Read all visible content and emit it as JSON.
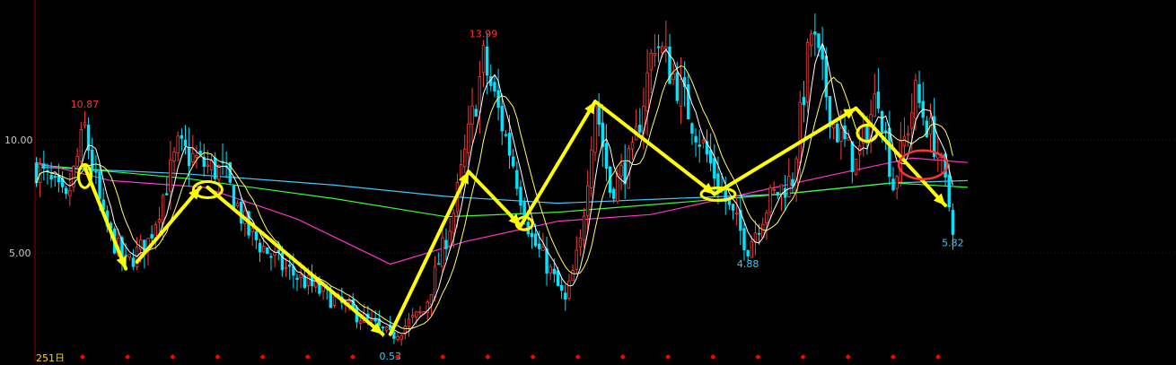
{
  "colors": {
    "background": "#000000",
    "axis": "#8b0000",
    "grid": "#7a0000",
    "axis_label": "#c8c8c8",
    "up_candle": "#ff3c3c",
    "down_candle": "#00e5ff",
    "ma_short": "#ffffff",
    "ma_mid": "#ffff66",
    "ma_long_magenta": "#ff33cc",
    "ma_long_green": "#33ff33",
    "ma_long_cyan": "#3cc8ff",
    "annotation": "#ffff00",
    "annotation_circle_red": "#ff3333",
    "high_label": "#ff3333",
    "low_label": "#33ccff",
    "date_label": "#ffd700",
    "event_marker": "#ff0000"
  },
  "chart_data": {
    "type": "candlestick",
    "y_axis": {
      "ticks": [
        "10.00",
        "5.00"
      ],
      "tick_values": [
        10,
        5
      ],
      "range": [
        0.3,
        15.9
      ]
    },
    "x_axis": {
      "label": "251日",
      "event_markers": 20
    },
    "price_labels": [
      {
        "text": "10.87",
        "value": 10.87,
        "kind": "high",
        "bar": 13
      },
      {
        "text": "13.99",
        "value": 13.99,
        "kind": "high",
        "bar": 120
      },
      {
        "text": "4.88",
        "value": 4.88,
        "kind": "low",
        "bar": 191
      },
      {
        "text": "5.82",
        "value": 5.82,
        "kind": "low",
        "bar": 246
      },
      {
        "text": "0.53",
        "value": 0.53,
        "kind": "low",
        "bar": 95
      }
    ],
    "price_path": [
      [
        0,
        8.8
      ],
      [
        8,
        7.2
      ],
      [
        13,
        10.5
      ],
      [
        18,
        6.4
      ],
      [
        24,
        4.5
      ],
      [
        30,
        5.5
      ],
      [
        38,
        9.6
      ],
      [
        46,
        8.8
      ],
      [
        50,
        8.6
      ],
      [
        57,
        5.9
      ],
      [
        66,
        4.4
      ],
      [
        76,
        3.3
      ],
      [
        86,
        2.3
      ],
      [
        95,
        1.3
      ],
      [
        104,
        2.4
      ],
      [
        112,
        6.8
      ],
      [
        120,
        13.5
      ],
      [
        128,
        9.0
      ],
      [
        133,
        5.6
      ],
      [
        137,
        4.5
      ],
      [
        142,
        2.8
      ],
      [
        146,
        5.4
      ],
      [
        150,
        11.8
      ],
      [
        154,
        7.8
      ],
      [
        160,
        9.2
      ],
      [
        166,
        14.5
      ],
      [
        172,
        12.5
      ],
      [
        180,
        9.3
      ],
      [
        186,
        6.9
      ],
      [
        191,
        5.3
      ],
      [
        197,
        7.4
      ],
      [
        203,
        8.3
      ],
      [
        208,
        14.8
      ],
      [
        214,
        10.7
      ],
      [
        220,
        8.9
      ],
      [
        226,
        12.2
      ],
      [
        230,
        8.0
      ],
      [
        236,
        12.0
      ],
      [
        242,
        9.5
      ],
      [
        246,
        6.3
      ]
    ],
    "moving_averages": [
      {
        "name": "MA-cyan",
        "color_key": "ma_long_cyan",
        "points": [
          [
            0,
            8.8
          ],
          [
            40,
            8.5
          ],
          [
            80,
            8.0
          ],
          [
            110,
            7.5
          ],
          [
            140,
            7.2
          ],
          [
            170,
            7.4
          ],
          [
            200,
            7.6
          ],
          [
            230,
            8.1
          ],
          [
            250,
            8.2
          ]
        ]
      },
      {
        "name": "MA-green",
        "color_key": "ma_long_green",
        "points": [
          [
            0,
            8.9
          ],
          [
            40,
            8.3
          ],
          [
            80,
            7.4
          ],
          [
            110,
            6.6
          ],
          [
            140,
            6.8
          ],
          [
            170,
            7.2
          ],
          [
            200,
            7.6
          ],
          [
            230,
            8.1
          ],
          [
            250,
            7.9
          ]
        ]
      },
      {
        "name": "MA-magenta",
        "color_key": "ma_long_magenta",
        "points": [
          [
            0,
            9.0
          ],
          [
            20,
            8.2
          ],
          [
            45,
            7.9
          ],
          [
            70,
            6.5
          ],
          [
            95,
            4.5
          ],
          [
            115,
            5.5
          ],
          [
            140,
            6.4
          ],
          [
            165,
            6.7
          ],
          [
            190,
            7.6
          ],
          [
            215,
            8.5
          ],
          [
            235,
            9.2
          ],
          [
            250,
            9.0
          ]
        ]
      }
    ],
    "annotations": {
      "arrows": [
        [
          [
            13,
            8.8
          ],
          [
            24,
            4.3
          ]
        ],
        [
          [
            27,
            4.6
          ],
          [
            44,
            7.9
          ]
        ],
        [
          [
            46,
            7.9
          ],
          [
            93,
            1.4
          ]
        ],
        [
          [
            95,
            1.4
          ],
          [
            116,
            8.6
          ]
        ],
        [
          [
            116,
            8.6
          ],
          [
            130,
            6.2
          ]
        ],
        [
          [
            130,
            6.2
          ],
          [
            150,
            11.7
          ]
        ],
        [
          [
            150,
            11.7
          ],
          [
            182,
            7.6
          ]
        ],
        [
          [
            182,
            7.6
          ],
          [
            220,
            11.4
          ]
        ],
        [
          [
            220,
            11.4
          ],
          [
            244,
            7.1
          ]
        ]
      ],
      "ellipses": [
        {
          "at": [
            13,
            8.4
          ],
          "rx": 7,
          "ry": 13
        },
        {
          "at": [
            46,
            7.8
          ],
          "rx": 16,
          "ry": 9
        },
        {
          "at": [
            131,
            6.3
          ],
          "rx": 9,
          "ry": 7
        },
        {
          "at": [
            183,
            7.6
          ],
          "rx": 19,
          "ry": 7
        },
        {
          "at": [
            223,
            10.3
          ],
          "rx": 11,
          "ry": 9
        }
      ],
      "red_ellipse": {
        "at": [
          238,
          8.9
        ],
        "rx": 27,
        "ry": 16
      }
    }
  }
}
